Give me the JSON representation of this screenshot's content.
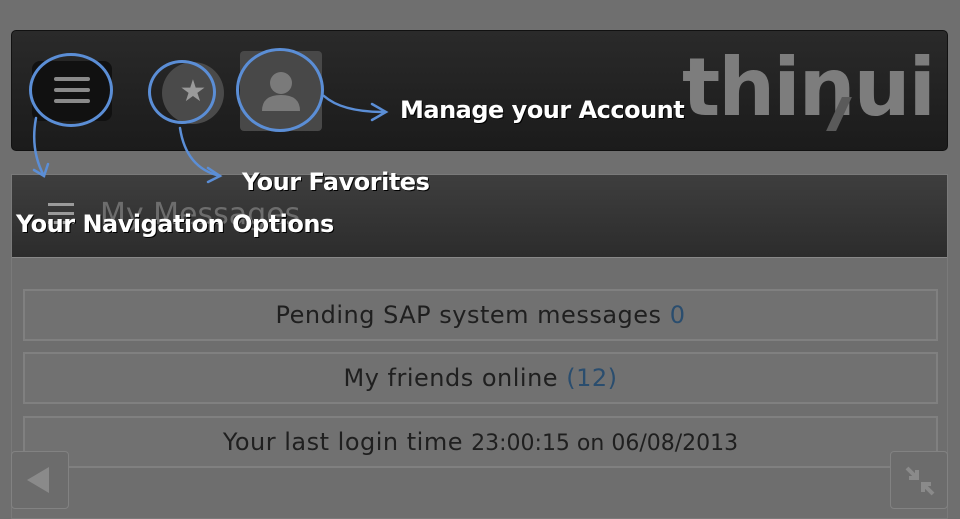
{
  "header": {
    "logo_text": "thinui",
    "menu_icon": "hamburger-icon",
    "favorites_icon": "star-icon",
    "account_icon": "user-icon"
  },
  "annotations": {
    "navigation": "Your Navigation Options",
    "favorites": "Your Favorites",
    "account": "Manage your Account",
    "highlight_color": "#5b8ed6"
  },
  "panel": {
    "title": "My Messages",
    "rows": [
      {
        "label": "Pending SAP system messages",
        "value": "0"
      },
      {
        "label": "My friends online",
        "value": "(12)"
      },
      {
        "label": "Your last login time",
        "value": "23:00:15 on 06/08/2013"
      }
    ]
  },
  "footer": {
    "back_icon": "back-arrow-icon",
    "minimize_icon": "minimize-icon"
  }
}
